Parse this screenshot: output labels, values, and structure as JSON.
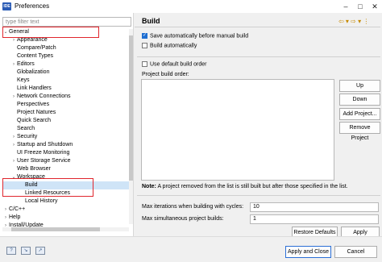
{
  "window": {
    "title": "Preferences",
    "app_icon_text": "IDE"
  },
  "filter": {
    "placeholder": "type filter text"
  },
  "tree": [
    {
      "label": "General",
      "indent": 0,
      "arrow": "down"
    },
    {
      "label": "Appearance",
      "indent": 1,
      "arrow": "right"
    },
    {
      "label": "Compare/Patch",
      "indent": 1,
      "arrow": ""
    },
    {
      "label": "Content Types",
      "indent": 1,
      "arrow": ""
    },
    {
      "label": "Editors",
      "indent": 1,
      "arrow": "right"
    },
    {
      "label": "Globalization",
      "indent": 1,
      "arrow": ""
    },
    {
      "label": "Keys",
      "indent": 1,
      "arrow": ""
    },
    {
      "label": "Link Handlers",
      "indent": 1,
      "arrow": ""
    },
    {
      "label": "Network Connections",
      "indent": 1,
      "arrow": "right"
    },
    {
      "label": "Perspectives",
      "indent": 1,
      "arrow": ""
    },
    {
      "label": "Project Natures",
      "indent": 1,
      "arrow": ""
    },
    {
      "label": "Quick Search",
      "indent": 1,
      "arrow": ""
    },
    {
      "label": "Search",
      "indent": 1,
      "arrow": ""
    },
    {
      "label": "Security",
      "indent": 1,
      "arrow": "right"
    },
    {
      "label": "Startup and Shutdown",
      "indent": 1,
      "arrow": "right"
    },
    {
      "label": "UI Freeze Monitoring",
      "indent": 1,
      "arrow": ""
    },
    {
      "label": "User Storage Service",
      "indent": 1,
      "arrow": "right"
    },
    {
      "label": "Web Browser",
      "indent": 1,
      "arrow": ""
    },
    {
      "label": "Workspace",
      "indent": 1,
      "arrow": "down"
    },
    {
      "label": "Build",
      "indent": 2,
      "arrow": "",
      "selected": true
    },
    {
      "label": "Linked Resources",
      "indent": 2,
      "arrow": ""
    },
    {
      "label": "Local History",
      "indent": 2,
      "arrow": ""
    },
    {
      "label": "C/C++",
      "indent": 0,
      "arrow": "right"
    },
    {
      "label": "Help",
      "indent": 0,
      "arrow": "right"
    },
    {
      "label": "Install/Update",
      "indent": 0,
      "arrow": "right"
    }
  ],
  "page": {
    "header": "Build",
    "nav_icons": "⇦ ▾ ⇨ ▾ ⋮",
    "save_before_build": {
      "label": "Save automatically before manual build",
      "checked": true
    },
    "build_automatically": {
      "label": "Build automatically",
      "checked": false
    },
    "use_default_order": {
      "label": "Use default build order",
      "checked": false
    },
    "build_order_label": "Project build order:",
    "buttons": {
      "up": "Up",
      "down": "Down",
      "add_project": "Add Project...",
      "remove_project": "Remove Project"
    },
    "note_bold": "Note:",
    "note_text": "A project removed from the list is still built but after those specified in the list.",
    "max_iterations_label": "Max iterations when building with cycles:",
    "max_iterations_value": "10",
    "max_parallel_label": "Max simultaneous project builds:",
    "max_parallel_value": "1",
    "restore_defaults": "Restore Defaults",
    "apply": "Apply"
  },
  "footer": {
    "apply_and_close": "Apply and Close",
    "cancel": "Cancel",
    "icons": [
      "help-icon",
      "import-icon",
      "export-icon"
    ]
  },
  "colors": {
    "highlight": "#e0262d",
    "selection": "#cfe4f7",
    "accent": "#1f6fd1"
  }
}
